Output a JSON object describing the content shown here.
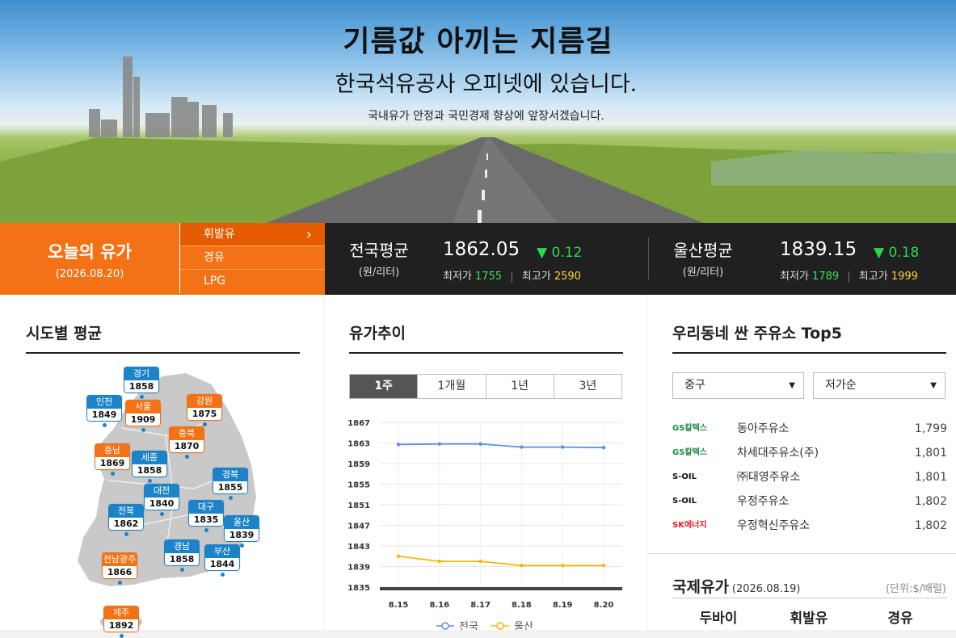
{
  "hero": {
    "title": "기름값 아끼는 지름길",
    "subtitle": "한국석유공사 오피넷에 있습니다.",
    "tagline": "국내유가 안정과 국민경제 향상에 앞장서겠습니다."
  },
  "today": {
    "label": "오늘의 유가",
    "date": "(2026.08.20)"
  },
  "fuel_menu": [
    {
      "label": "휘발유",
      "active": true
    },
    {
      "label": "경유",
      "active": false
    },
    {
      "label": "LPG",
      "active": false
    }
  ],
  "national": {
    "label": "전국평균",
    "unit": "(원/리터)",
    "value": "1862.05",
    "change": "▼ 0.12",
    "min_label": "최저가",
    "min": "1755",
    "max_label": "최고가",
    "max": "2590"
  },
  "ulsan": {
    "label": "울산평균",
    "unit": "(원/리터)",
    "value": "1839.15",
    "change": "▼ 0.18",
    "min_label": "최저가",
    "min": "1789",
    "max_label": "최고가",
    "max": "1999"
  },
  "regions_panel": {
    "title": "시도별 평균",
    "regions": [
      {
        "name": "경기",
        "price": "1858",
        "color": "blue"
      },
      {
        "name": "인천",
        "price": "1849",
        "color": "blue"
      },
      {
        "name": "서울",
        "price": "1909",
        "color": "orange"
      },
      {
        "name": "강원",
        "price": "1875",
        "color": "orange"
      },
      {
        "name": "충북",
        "price": "1870",
        "color": "orange"
      },
      {
        "name": "충남",
        "price": "1869",
        "color": "orange"
      },
      {
        "name": "세종",
        "price": "1858",
        "color": "blue"
      },
      {
        "name": "경북",
        "price": "1855",
        "color": "blue"
      },
      {
        "name": "대전",
        "price": "1840",
        "color": "blue"
      },
      {
        "name": "대구",
        "price": "1835",
        "color": "blue"
      },
      {
        "name": "전북",
        "price": "1862",
        "color": "blue"
      },
      {
        "name": "울산",
        "price": "1839",
        "color": "blue"
      },
      {
        "name": "경남",
        "price": "1858",
        "color": "blue"
      },
      {
        "name": "부산",
        "price": "1844",
        "color": "blue"
      },
      {
        "name": "전남광주",
        "price": "1866",
        "color": "orange"
      },
      {
        "name": "제주",
        "price": "1892",
        "color": "orange"
      }
    ]
  },
  "trend_panel": {
    "title": "유가추이",
    "tabs": [
      {
        "label": "1주",
        "active": true
      },
      {
        "label": "1개월",
        "active": false
      },
      {
        "label": "1년",
        "active": false
      },
      {
        "label": "3년",
        "active": false
      }
    ]
  },
  "chart_data": {
    "type": "line",
    "categories": [
      "8.15",
      "8.16",
      "8.17",
      "8.18",
      "8.19",
      "8.20"
    ],
    "y_ticks": [
      "1867",
      "1863",
      "1859",
      "1855",
      "1851",
      "1847",
      "1843",
      "1839",
      "1835"
    ],
    "ylim": [
      1835,
      1867
    ],
    "grid": true,
    "legend_position": "bottom",
    "series": [
      {
        "name": "전국",
        "color": "#5b8fe0",
        "values": [
          1862.7,
          1862.8,
          1862.8,
          1862.2,
          1862.2,
          1862.1
        ]
      },
      {
        "name": "울산",
        "color": "#f5b800",
        "values": [
          1841.0,
          1840.0,
          1840.0,
          1839.2,
          1839.2,
          1839.2
        ]
      }
    ]
  },
  "top5_panel": {
    "title": "우리동네 싼 주유소 Top5",
    "district": "중구",
    "sort": "저가순",
    "stations": [
      {
        "brand": "GS칼텍스",
        "name": "동아주유소",
        "price": "1,799",
        "brand_color": "#1b8a3c"
      },
      {
        "brand": "GS칼텍스",
        "name": "차세대주유소(주)",
        "price": "1,801",
        "brand_color": "#1b8a3c"
      },
      {
        "brand": "S-OIL",
        "name": "㈜대영주유소",
        "price": "1,801",
        "brand_color": "#111111"
      },
      {
        "brand": "S-OIL",
        "name": "우정주유소",
        "price": "1,802",
        "brand_color": "#111111"
      },
      {
        "brand": "SK에너지",
        "name": "우정혁신주유소",
        "price": "1,802",
        "brand_color": "#e31b23"
      }
    ]
  },
  "intl_panel": {
    "title": "국제유가",
    "date": "(2026.08.19)",
    "unit": "(단위:$/배럴)",
    "headers": [
      "두바이",
      "휘발유",
      "경유"
    ]
  },
  "colors": {
    "accent": "#f47216",
    "bar_bg": "#202020",
    "up_green": "#2bd84a",
    "blue_badge": "#1d83c9"
  }
}
